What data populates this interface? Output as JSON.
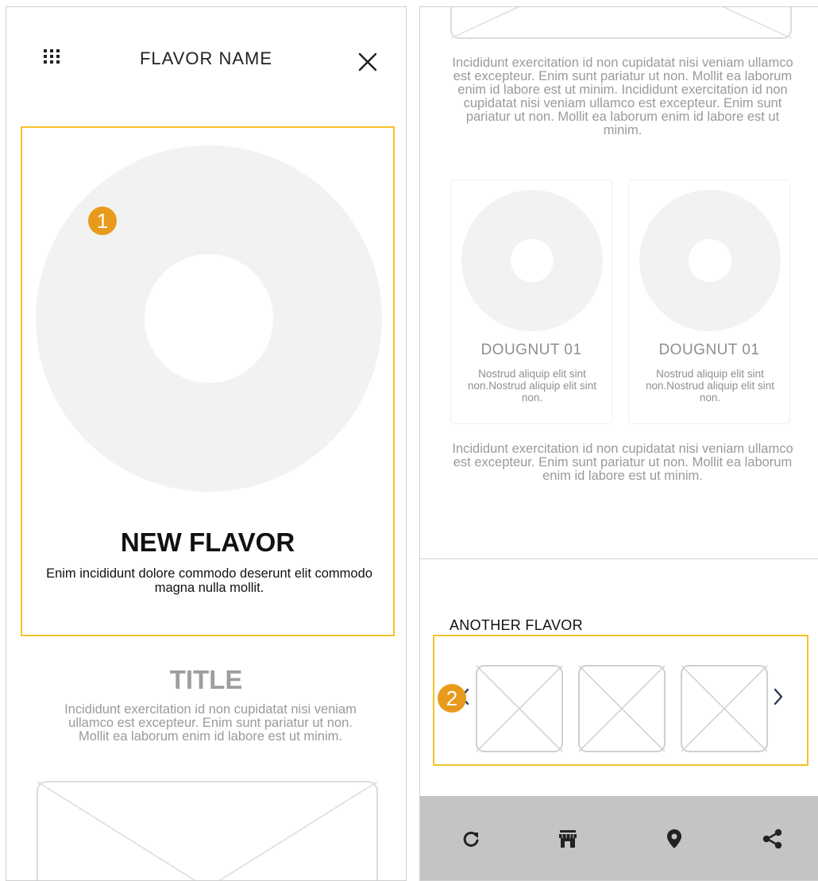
{
  "left_screen": {
    "header": {
      "menu_icon": "grid-icon",
      "title": "FLAVOR NAME",
      "close_icon": "close-icon"
    },
    "hero": {
      "annotation_number": "1",
      "title": "NEW FLAVOR",
      "description": "Enim incididunt dolore commodo deserunt elit commodo magna nulla mollit."
    },
    "section": {
      "title": "TITLE",
      "text": "Incididunt exercitation id non cupidatat nisi veniam ullamco est excepteur. Enim sunt pariatur ut non. Mollit ea laborum enim id labore est ut minim."
    }
  },
  "right_screen": {
    "text_top": "Incididunt exercitation id non cupidatat nisi veniam ullamco est excepteur. Enim sunt pariatur ut non. Mollit ea laborum enim id labore est ut minim. Incididunt exercitation id non cupidatat nisi veniam ullamco est excepteur. Enim sunt pariatur ut non. Mollit ea laborum enim id labore est ut minim.",
    "cards": [
      {
        "title": "DOUGNUT 01",
        "description": "Nostrud aliquip elit sint non.Nostrud aliquip elit sint non."
      },
      {
        "title": "DOUGNUT 01",
        "description": "Nostrud aliquip elit sint non.Nostrud aliquip elit sint non."
      }
    ],
    "text_bottom": "Incididunt exercitation id non cupidatat nisi veniam ullamco est excepteur. Enim sunt pariatur ut non. Mollit ea laborum enim id labore est ut minim.",
    "another_flavor": {
      "title": "ANOTHER FLAVOR",
      "annotation_number": "2",
      "prev_icon": "chevron-left-icon",
      "next_icon": "chevron-right-icon"
    },
    "bottom_nav": {
      "items": [
        "refresh-icon",
        "store-icon",
        "location-icon",
        "share-icon"
      ],
      "background": "#c4c4c4"
    }
  },
  "colors": {
    "highlight_border": "#f5c22a",
    "annotation_badge": "#e89a1c",
    "placeholder_fill": "#f2f2f2",
    "muted_text": "#9a9a9a"
  }
}
